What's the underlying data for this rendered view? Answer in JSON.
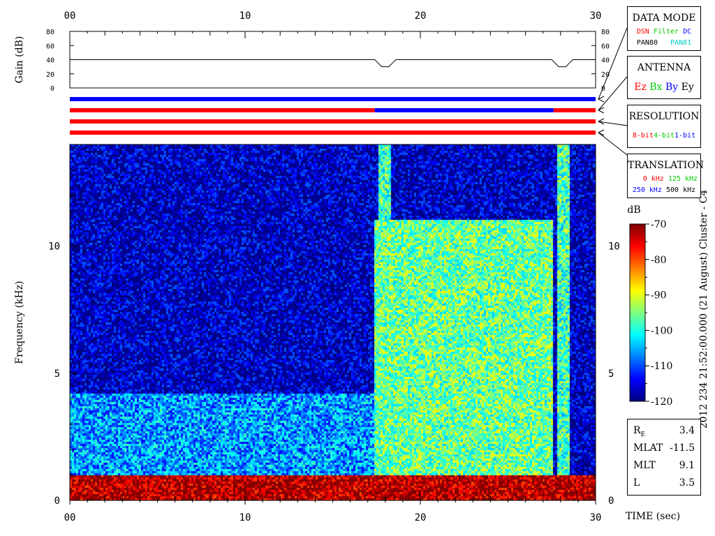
{
  "time_axis": {
    "label": "TIME (sec)",
    "ticks": [
      "00",
      "10",
      "20",
      "30"
    ],
    "range": [
      0,
      30
    ]
  },
  "gain_panel": {
    "ylabel": "Gain (dB)",
    "ticks": [
      "0",
      "20",
      "40",
      "60",
      "80"
    ],
    "range": [
      0,
      80
    ]
  },
  "spectrogram": {
    "ylabel": "Frequency (kHz)",
    "ticks": [
      "0",
      "5",
      "10"
    ],
    "range": [
      0,
      14
    ]
  },
  "colorbar": {
    "unit": "dB",
    "ticks": [
      "-70",
      "-80",
      "-90",
      "-100",
      "-110",
      "-120"
    ],
    "range": [
      -120,
      -70
    ]
  },
  "side_caption": "2012 234 21:52:00.000 (21 August)  Cluster - C4",
  "legends": {
    "data_mode": {
      "title": "DATA MODE",
      "row1": [
        {
          "text": "DSN",
          "color": "#ff0000"
        },
        {
          "text": "Filter",
          "color": "#00cc00"
        },
        {
          "text": "DC",
          "color": "#0000ff"
        }
      ],
      "row2": [
        {
          "text": "PAN80",
          "color": "#000000"
        },
        {
          "text": "PAN81",
          "color": "#00cccc"
        }
      ]
    },
    "antenna": {
      "title": "ANTENNA",
      "items": [
        {
          "text": "Ez",
          "color": "#ff0000"
        },
        {
          "text": "Bx",
          "color": "#00cc00"
        },
        {
          "text": "By",
          "color": "#0000ff"
        },
        {
          "text": "Ey",
          "color": "#000000"
        }
      ]
    },
    "resolution": {
      "title": "RESOLUTION",
      "items": [
        {
          "text": "8-bit",
          "color": "#ff0000"
        },
        {
          "text": "4-bit",
          "color": "#00cc00"
        },
        {
          "text": "1-bit",
          "color": "#0000ff"
        }
      ]
    },
    "translation": {
      "title": "TRANSLATION",
      "row1": [
        {
          "text": "0 kHz",
          "color": "#ff0000"
        },
        {
          "text": "125 kHz",
          "color": "#00cc00"
        }
      ],
      "row2": [
        {
          "text": "250 kHz",
          "color": "#0000ff"
        },
        {
          "text": "500 kHz",
          "color": "#000000"
        }
      ]
    }
  },
  "position": [
    {
      "label": "R",
      "sub": "E",
      "value": "3.4"
    },
    {
      "label": "MLAT",
      "sub": "",
      "value": "-11.5"
    },
    {
      "label": "MLT",
      "sub": "",
      "value": "9.1"
    },
    {
      "label": "L",
      "sub": "",
      "value": "3.5"
    }
  ],
  "chart_data": [
    {
      "type": "line",
      "name": "gain",
      "ylabel": "Gain (dB)",
      "ylim": [
        0,
        80
      ],
      "xlim": [
        0,
        30
      ],
      "x": [
        0,
        17.4,
        17.6,
        17.8,
        18.2,
        18.4,
        18.6,
        27.5,
        27.7,
        27.9,
        28.3,
        28.5,
        28.7,
        30
      ],
      "y": [
        40,
        40,
        35,
        30,
        30,
        35,
        40,
        40,
        35,
        30,
        30,
        35,
        40,
        40
      ]
    },
    {
      "type": "bar",
      "name": "status_bars",
      "segments": [
        [
          {
            "x0": 0,
            "x1": 30,
            "color": "#0000ff"
          }
        ],
        [
          {
            "x0": 0,
            "x1": 17.4,
            "color": "#ff0000"
          },
          {
            "x0": 17.4,
            "x1": 27.6,
            "color": "#0000ff"
          },
          {
            "x0": 27.6,
            "x1": 30,
            "color": "#ff0000"
          }
        ],
        [
          {
            "x0": 0,
            "x1": 30,
            "color": "#ff0000"
          }
        ],
        [
          {
            "x0": 0,
            "x1": 30,
            "color": "#ff0000"
          }
        ]
      ]
    },
    {
      "type": "heatmap",
      "name": "spectrogram",
      "xlabel": "TIME (sec)",
      "ylabel": "Frequency (kHz)",
      "xlim": [
        0,
        30
      ],
      "ylim": [
        0,
        14
      ],
      "zlim": [
        -120,
        -70
      ],
      "zlabel": "dB",
      "features": [
        {
          "desc": "background noise",
          "level_db": -117
        },
        {
          "desc": "hiss band",
          "x": [
            0,
            17.4
          ],
          "f": [
            0,
            4.2
          ],
          "level_db": -106
        },
        {
          "desc": "enhanced emission",
          "x": [
            17.4,
            27.6
          ],
          "f": [
            0,
            11
          ],
          "level_db": -96
        },
        {
          "desc": "burst",
          "x": [
            17.6,
            18.4
          ],
          "f": [
            0,
            14
          ],
          "level_db": -98
        },
        {
          "desc": "burst",
          "x": [
            27.8,
            28.6
          ],
          "f": [
            0,
            14
          ],
          "level_db": -98
        },
        {
          "desc": "low-frequency band",
          "x": [
            0,
            30
          ],
          "f": [
            0,
            1
          ],
          "level_db": -72
        }
      ]
    }
  ]
}
